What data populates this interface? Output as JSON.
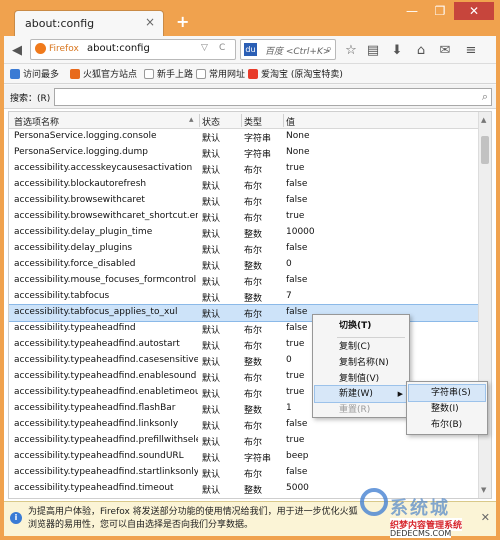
{
  "tab": {
    "title": "about:config",
    "close": "×",
    "newtab": "+"
  },
  "window_controls": {
    "minimize": "—",
    "restore": "❐",
    "close": "✕"
  },
  "navbar": {
    "browser_label": "Firefox",
    "url": "about:config",
    "url_dropdown": "▽",
    "url_reload": "C",
    "search_placeholder": "百度 <Ctrl+K>",
    "search_engine": "du"
  },
  "bookmarks": [
    {
      "label": "访问最多",
      "color": "#3b7bd4"
    },
    {
      "label": "火狐官方站点",
      "color": "#e86a1c"
    },
    {
      "label": "新手上路",
      "color": "#ffffff"
    },
    {
      "label": "常用网址",
      "color": "#ffffff"
    },
    {
      "label": "爱淘宝 (原淘宝特卖)",
      "color": "#e83b2a"
    }
  ],
  "search": {
    "label": "搜索：(R)",
    "value": ""
  },
  "columns": {
    "name": "首选项名称",
    "status": "状态",
    "type": "类型",
    "value": "值"
  },
  "rows": [
    {
      "name": "PersonaService.logging.console",
      "status": "默认",
      "type": "字符串",
      "value": "None"
    },
    {
      "name": "PersonaService.logging.dump",
      "status": "默认",
      "type": "字符串",
      "value": "None"
    },
    {
      "name": "accessibility.accesskeycausesactivation",
      "status": "默认",
      "type": "布尔",
      "value": "true"
    },
    {
      "name": "accessibility.blockautorefresh",
      "status": "默认",
      "type": "布尔",
      "value": "false"
    },
    {
      "name": "accessibility.browsewithcaret",
      "status": "默认",
      "type": "布尔",
      "value": "false"
    },
    {
      "name": "accessibility.browsewithcaret_shortcut.en…",
      "status": "默认",
      "type": "布尔",
      "value": "true"
    },
    {
      "name": "accessibility.delay_plugin_time",
      "status": "默认",
      "type": "整数",
      "value": "10000"
    },
    {
      "name": "accessibility.delay_plugins",
      "status": "默认",
      "type": "布尔",
      "value": "false"
    },
    {
      "name": "accessibility.force_disabled",
      "status": "默认",
      "type": "整数",
      "value": "0"
    },
    {
      "name": "accessibility.mouse_focuses_formcontrol",
      "status": "默认",
      "type": "布尔",
      "value": "false"
    },
    {
      "name": "accessibility.tabfocus",
      "status": "默认",
      "type": "整数",
      "value": "7"
    },
    {
      "name": "accessibility.tabfocus_applies_to_xul",
      "status": "默认",
      "type": "布尔",
      "value": "false"
    },
    {
      "name": "accessibility.typeaheadfind",
      "status": "默认",
      "type": "布尔",
      "value": "false"
    },
    {
      "name": "accessibility.typeaheadfind.autostart",
      "status": "默认",
      "type": "布尔",
      "value": "true"
    },
    {
      "name": "accessibility.typeaheadfind.casesensitive",
      "status": "默认",
      "type": "整数",
      "value": "0"
    },
    {
      "name": "accessibility.typeaheadfind.enablesound",
      "status": "默认",
      "type": "布尔",
      "value": "true"
    },
    {
      "name": "accessibility.typeaheadfind.enabletimeout",
      "status": "默认",
      "type": "布尔",
      "value": "true"
    },
    {
      "name": "accessibility.typeaheadfind.flashBar",
      "status": "默认",
      "type": "整数",
      "value": "1"
    },
    {
      "name": "accessibility.typeaheadfind.linksonly",
      "status": "默认",
      "type": "布尔",
      "value": "false"
    },
    {
      "name": "accessibility.typeaheadfind.prefillwithsele…",
      "status": "默认",
      "type": "布尔",
      "value": "true"
    },
    {
      "name": "accessibility.typeaheadfind.soundURL",
      "status": "默认",
      "type": "字符串",
      "value": "beep"
    },
    {
      "name": "accessibility.typeaheadfind.startlinksonly",
      "status": "默认",
      "type": "布尔",
      "value": "false"
    },
    {
      "name": "accessibility.typeaheadfind.timeout",
      "status": "默认",
      "type": "整数",
      "value": "5000"
    }
  ],
  "selected_row_index": 11,
  "context_menu": {
    "toggle": "切换(T)",
    "copy": "复制(C)",
    "copy_name": "复制名称(N)",
    "copy_value": "复制值(V)",
    "new": "新建(W)",
    "reset": "重置(R)"
  },
  "submenu": {
    "string": "字符串(S)",
    "integer": "整数(I)",
    "boolean": "布尔(B)"
  },
  "infobar": {
    "text": "为提高用户体验，Firefox 将发送部分功能的使用情况给我们，用于进一步优化火狐浏览器的易用性，您可以自由选择是否向我们分享数据。",
    "close": "✕"
  },
  "watermark": {
    "title": "系统城",
    "line1": "织梦内容管理系统",
    "line2": "DEDECMS.COM"
  }
}
